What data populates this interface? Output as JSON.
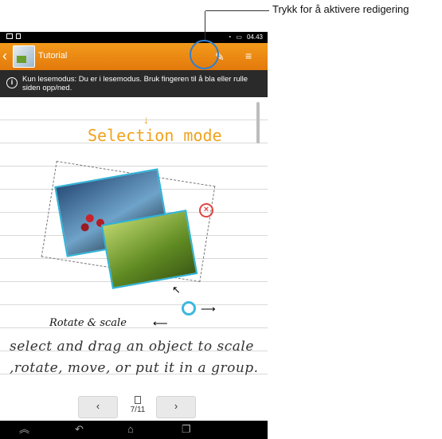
{
  "status_bar": {
    "time": "04.43"
  },
  "action_bar": {
    "back_label": "‹",
    "title": "Tutorial"
  },
  "notice": {
    "icon_label": "i",
    "text": "Kun lesemodus: Du er i lesemodus. Bruk fingeren til å bla eller rulle siden opp/ned."
  },
  "page": {
    "heading": "Selection mode",
    "rotate_label": "Rotate & scale",
    "handwriting_line1": "select and drag an object to scale",
    "handwriting_line2": ",rotate, move, or put it in a group."
  },
  "pager": {
    "prev_label": "‹",
    "next_label": "›",
    "page_indicator": "7/11"
  },
  "annotation": {
    "callout_text": "Trykk for å aktivere redigering"
  },
  "colors": {
    "action_bar": "#e98a13",
    "accent": "#f0a21c",
    "selection": "#2fb3d8",
    "callout_ring": "#2f7fd1"
  }
}
